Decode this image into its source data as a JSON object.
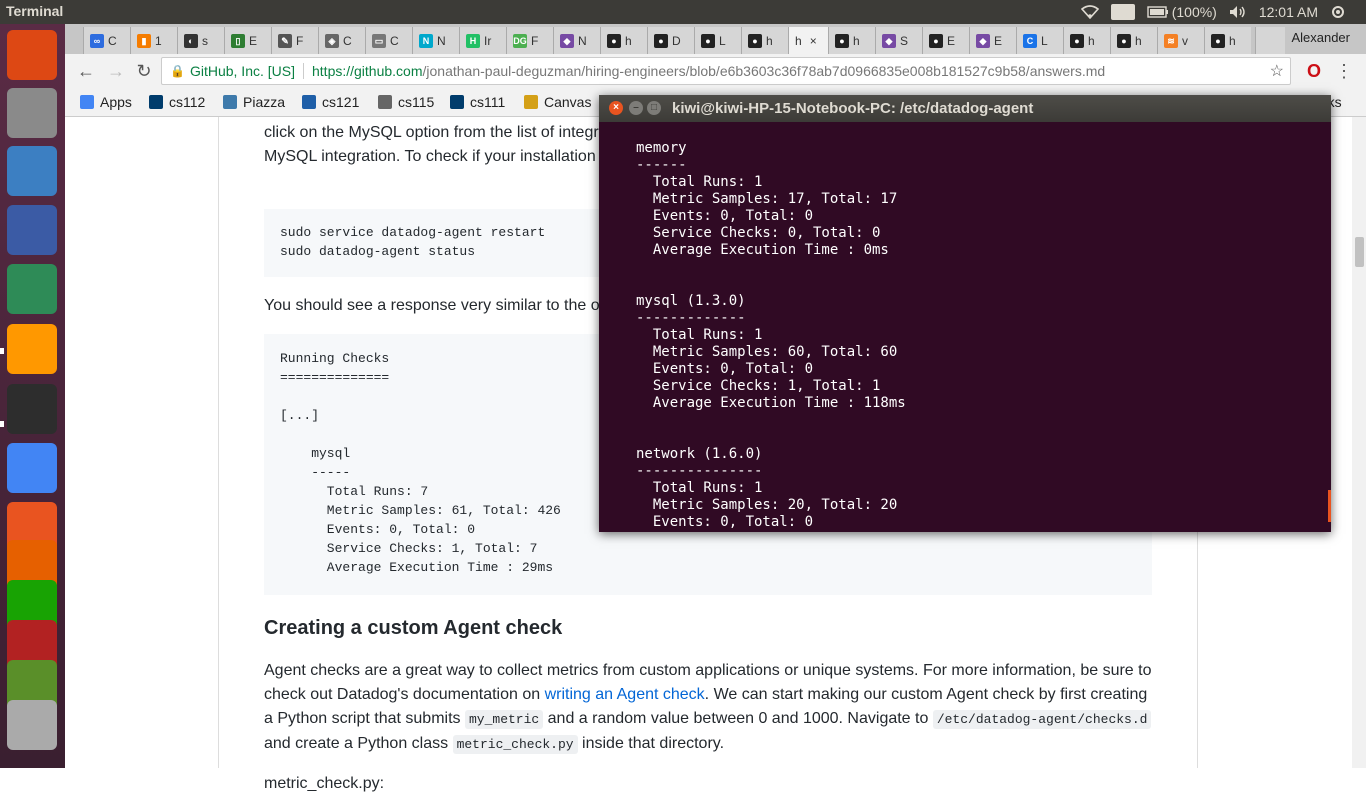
{
  "top_panel": {
    "app_title": "Terminal",
    "keyboard_layout": "En",
    "battery": "(100%)",
    "time": "12:01 AM"
  },
  "launcher": {
    "items": [
      {
        "name": "ubuntu-dash-icon",
        "color": "#dd4814"
      },
      {
        "name": "files-icon",
        "color": "#8a8a8a"
      },
      {
        "name": "lock-app-icon",
        "color": "#3c7fc2"
      },
      {
        "name": "gedit-icon",
        "color": "#3b5ba5"
      },
      {
        "name": "atom-icon",
        "color": "#2e8b57"
      },
      {
        "name": "sublime-text-icon",
        "color": "#ff9800"
      },
      {
        "name": "terminal-app-icon",
        "color": "#2d2d2d"
      },
      {
        "name": "chrome-app-icon",
        "color": "#4285f4"
      },
      {
        "name": "ubuntu-software-icon",
        "color": "#e95420"
      },
      {
        "name": "firefox-icon",
        "color": "#e66000"
      },
      {
        "name": "libreoffice-icon",
        "color": "#18a303"
      },
      {
        "name": "settings-icon",
        "color": "#b22222"
      },
      {
        "name": "system-monitor-icon",
        "color": "#5a8f29"
      },
      {
        "name": "workspace-switcher-icon",
        "color": "#aaaaaa"
      }
    ]
  },
  "browser": {
    "profile_name": "Alexander",
    "tabs": [
      {
        "label": "C",
        "icon": "∞",
        "color": "#2d6cdf"
      },
      {
        "label": "1",
        "icon": "▮",
        "color": "#f57c00"
      },
      {
        "label": "s",
        "icon": "◐",
        "color": "#333333"
      },
      {
        "label": "E",
        "icon": "▯",
        "color": "#2e7d32"
      },
      {
        "label": "F",
        "icon": "✎",
        "color": "#555555"
      },
      {
        "label": "C",
        "icon": "◈",
        "color": "#666666"
      },
      {
        "label": "C",
        "icon": "▭",
        "color": "#777777"
      },
      {
        "label": "N",
        "icon": "N",
        "color": "#00a8cc"
      },
      {
        "label": "Ir",
        "icon": "H",
        "color": "#21c065"
      },
      {
        "label": "F",
        "icon": "DG",
        "color": "#4caf50"
      },
      {
        "label": "N",
        "icon": "◆",
        "color": "#774aa4"
      },
      {
        "label": "h",
        "icon": "●",
        "color": "#222222"
      },
      {
        "label": "D",
        "icon": "●",
        "color": "#222222"
      },
      {
        "label": "L",
        "icon": "●",
        "color": "#222222"
      },
      {
        "label": "h",
        "icon": "●",
        "color": "#222222"
      },
      {
        "label": "h",
        "icon": "",
        "color": "#f2f2f2",
        "active": true
      },
      {
        "label": "h",
        "icon": "●",
        "color": "#222222"
      },
      {
        "label": "S",
        "icon": "◆",
        "color": "#774aa4"
      },
      {
        "label": "E",
        "icon": "●",
        "color": "#222222"
      },
      {
        "label": "E",
        "icon": "◆",
        "color": "#774aa4"
      },
      {
        "label": "L",
        "icon": "C",
        "color": "#1a73e8"
      },
      {
        "label": "h",
        "icon": "●",
        "color": "#222222"
      },
      {
        "label": "h",
        "icon": "●",
        "color": "#222222"
      },
      {
        "label": "v",
        "icon": "≋",
        "color": "#f48024"
      },
      {
        "label": "h",
        "icon": "●",
        "color": "#222222"
      }
    ],
    "close_glyph": "×",
    "omnibox": {
      "secure_label": "GitHub, Inc. [US]",
      "url_prefix": "https://github.com",
      "url_path": "/jonathan-paul-deguzman/hiring-engineers/blob/e6b3603c36f78ab7d0966835e008b181527c9b58/answers.md"
    },
    "bookmarks": [
      {
        "label": "Apps",
        "color": "#4285f4"
      },
      {
        "label": "cs112",
        "color": "#003c6c"
      },
      {
        "label": "Piazza",
        "color": "#3e7aab"
      },
      {
        "label": "cs121",
        "color": "#1f5fa8"
      },
      {
        "label": "cs115",
        "color": "#666666"
      },
      {
        "label": "cs111",
        "color": "#003c6c"
      },
      {
        "label": "Canvas",
        "color": "#d4a017"
      }
    ],
    "bookmarks_overflow": "rks"
  },
  "page": {
    "para1_line1": "click on the MySQL option from the list of integr",
    "para1_line2": "MySQL integration. To check if your installation",
    "code1": [
      "sudo service datadog-agent restart",
      "sudo datadog-agent status"
    ],
    "para2": "You should see a response very similar to the o",
    "code2": [
      "Running Checks",
      "==============",
      "",
      "[...]",
      "",
      "    mysql",
      "    -----",
      "      Total Runs: 7",
      "      Metric Samples: 61, Total: 426",
      "      Events: 0, Total: 0",
      "      Service Checks: 1, Total: 7",
      "      Average Execution Time : 29ms"
    ],
    "heading": "Creating a custom Agent check",
    "para3": {
      "t1": "Agent checks are a great way to collect metrics from custom applications or unique systems. For more information, be sure to check out Datadog's documentation on ",
      "link": "writing an Agent check",
      "t2": ". We can start making our custom Agent check by first creating a Python script that submits ",
      "code1": "my_metric",
      "t3": " and a random value between 0 and 1000. Navigate to ",
      "code2": "/etc/datadog-agent/checks.d",
      "t4": " and create a Python class ",
      "code3": "metric_check.py",
      "t5": " inside that directory."
    },
    "para4": "metric_check.py:"
  },
  "terminal": {
    "title": "kiwi@kiwi-HP-15-Notebook-PC: /etc/datadog-agent",
    "lines": [
      "memory",
      "------",
      "  Total Runs: 1",
      "  Metric Samples: 17, Total: 17",
      "  Events: 0, Total: 0",
      "  Service Checks: 0, Total: 0",
      "  Average Execution Time : 0ms",
      "",
      "",
      "mysql (1.3.0)",
      "-------------",
      "  Total Runs: 1",
      "  Metric Samples: 60, Total: 60",
      "  Events: 0, Total: 0",
      "  Service Checks: 1, Total: 1",
      "  Average Execution Time : 118ms",
      "",
      "",
      "network (1.6.0)",
      "---------------",
      "  Total Runs: 1",
      "  Metric Samples: 20, Total: 20",
      "  Events: 0, Total: 0"
    ]
  }
}
